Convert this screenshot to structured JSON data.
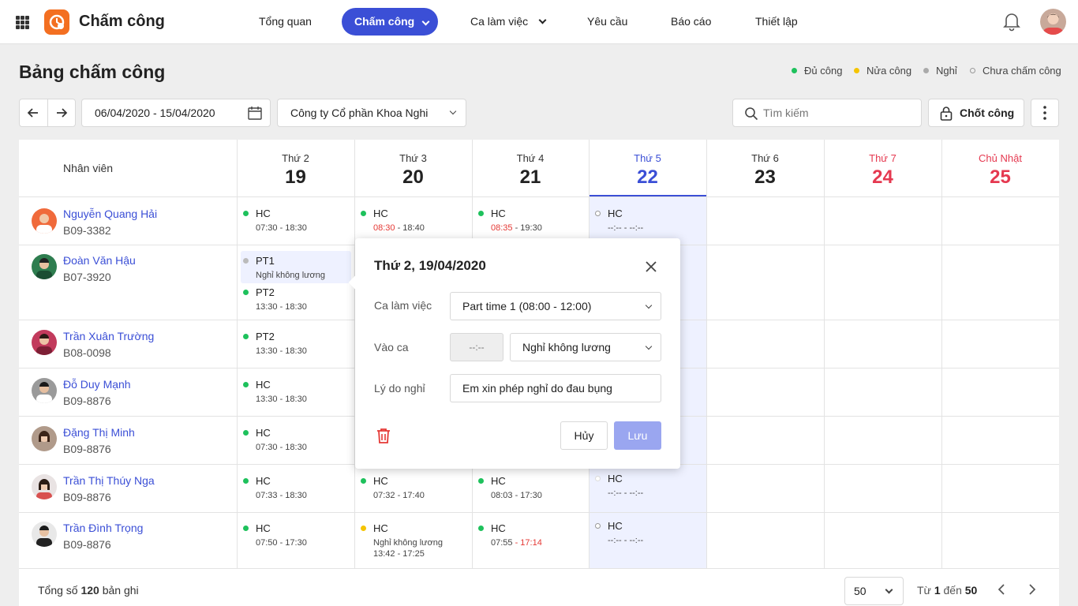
{
  "app": {
    "title": "Chấm công"
  },
  "nav": {
    "overview": "Tổng quan",
    "attendance": "Chấm công",
    "shifts": "Ca làm việc",
    "requests": "Yêu cầu",
    "reports": "Báo cáo",
    "settings": "Thiết lập"
  },
  "page": {
    "title": "Bảng chấm công"
  },
  "legend": [
    {
      "label": "Đủ công",
      "color": "#1ec15c"
    },
    {
      "label": "Nửa công",
      "color": "#f5c400"
    },
    {
      "label": "Nghỉ",
      "color": "#aaaaaa"
    },
    {
      "label": "Chưa chấm công",
      "color": "#ffffff"
    }
  ],
  "toolbar": {
    "date_range": "06/04/2020 - 15/04/2020",
    "company": "Công ty Cổ phần Khoa Nghi",
    "search_placeholder": "Tìm kiếm",
    "lock_label": "Chốt công"
  },
  "table": {
    "employee_header": "Nhân viên",
    "days": [
      {
        "label": "Thứ 2",
        "num": "19"
      },
      {
        "label": "Thứ 3",
        "num": "20"
      },
      {
        "label": "Thứ 4",
        "num": "21"
      },
      {
        "label": "Thứ 5",
        "num": "22"
      },
      {
        "label": "Thứ 6",
        "num": "23"
      },
      {
        "label": "Thứ 7",
        "num": "24"
      },
      {
        "label": "Chủ Nhật",
        "num": "25"
      }
    ],
    "employees": [
      {
        "name": "Nguyễn Quang Hải",
        "code": "B09-3382"
      },
      {
        "name": "Đoàn Văn Hậu",
        "code": "B07-3920"
      },
      {
        "name": "Trần Xuân Trường",
        "code": "B08-0098"
      },
      {
        "name": "Đỗ Duy Mạnh",
        "code": "B09-8876"
      },
      {
        "name": "Đặng Thị Minh",
        "code": "B09-8876"
      },
      {
        "name": "Trần Thị Thúy Nga",
        "code": "B09-8876"
      },
      {
        "name": "Trần Đình Trọng",
        "code": "B09-8876"
      }
    ],
    "cells": {
      "r0": {
        "mon_s": "HC",
        "mon_t": "07:30 - 18:30",
        "tue_s": "HC",
        "tue_in": "08:30",
        "tue_out": " - 18:40",
        "wed_s": "HC",
        "wed_in": "08:35",
        "wed_out": " - 19:30",
        "thu_s": "HC",
        "thu_t": "--:-- - --:--"
      },
      "r1": {
        "a_s": "PT1",
        "a_note": "Nghỉ không lương",
        "b_s": "PT2",
        "b_t": "13:30 - 18:30"
      },
      "r2": {
        "mon_s": "PT2",
        "mon_t": "13:30 - 18:30"
      },
      "r3": {
        "mon_s": "HC",
        "mon_t": "13:30 - 18:30"
      },
      "r4": {
        "mon_s": "HC",
        "mon_t": "07:30 - 18:30"
      },
      "r5": {
        "mon_s": "HC",
        "mon_t": "07:33 - 18:30",
        "tue_s": "HC",
        "tue_t": "07:32 - 17:40",
        "wed_s": "HC",
        "wed_t": "08:03 - 17:30",
        "thu_s": "HC",
        "thu_t": "--:-- - --:--"
      },
      "r6": {
        "mon_s": "HC",
        "mon_t": "07:50 - 17:30",
        "tue_s": "HC",
        "tue_note": "Nghỉ không lương",
        "tue_t": "13:42 - 17:25",
        "wed_s": "HC",
        "wed_in": "07:55",
        "wed_out": " - 17:14",
        "thu_s": "HC",
        "thu_t": "--:-- - --:--"
      }
    }
  },
  "footer": {
    "total_prefix": "Tổng số ",
    "total": "120",
    "total_suffix": " bản ghi",
    "page_size": "50",
    "from": "Từ ",
    "start": "1",
    "to": " đến ",
    "end": "50"
  },
  "popup": {
    "title": "Thứ 2, 19/04/2020",
    "shift_label": "Ca làm việc",
    "shift_value": "Part time 1 (08:00 - 12:00)",
    "checkin_label": "Vào ca",
    "checkin_time": "--:--",
    "checkin_type": "Nghỉ không lương",
    "reason_label": "Lý do nghỉ",
    "reason_value": "Em xin phép nghỉ do đau bụng",
    "cancel": "Hủy",
    "save": "Lưu"
  }
}
